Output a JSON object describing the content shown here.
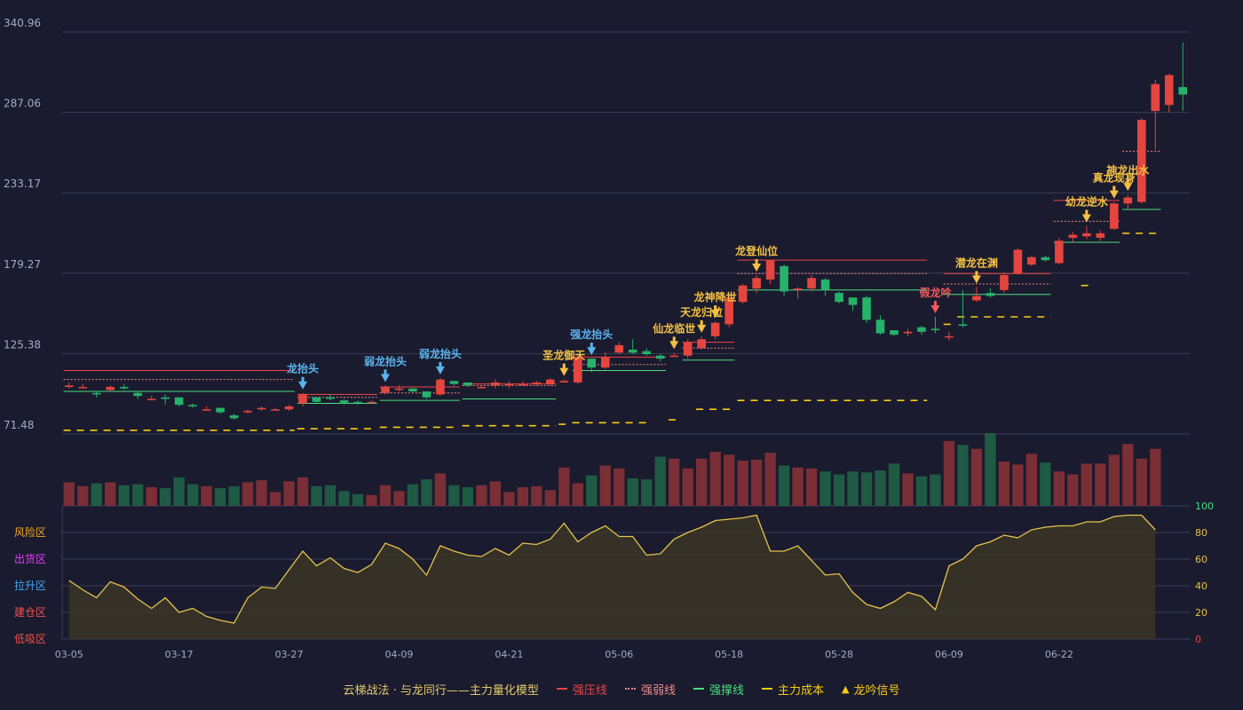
{
  "legend": {
    "title": "云梯战法 · 与龙同行——主力量化模型",
    "items": [
      {
        "label": "强压线",
        "color": "#ef4444",
        "style": "solid"
      },
      {
        "label": "强弱线",
        "color": "#f08a8a",
        "style": "dotted"
      },
      {
        "label": "强撑线",
        "color": "#4ade80",
        "style": "solid"
      },
      {
        "label": "主力成本",
        "color": "#facc15",
        "style": "dashed"
      },
      {
        "label": "龙吟信号",
        "color": "#facc15",
        "style": "triangle"
      }
    ]
  },
  "colors": {
    "background": "#1a1b2e",
    "grid": "#3a3d56",
    "up": "#e5453f",
    "down": "#25b26a",
    "volume_up": "#7a2e36",
    "volume_down": "#1f5a44",
    "oscillator": "#e6c34a",
    "cost_line": "#facc15",
    "signal_gold": "#f5c142",
    "signal_blue": "#5ab4f0",
    "signal_red": "#f05a5a"
  },
  "zones": [
    {
      "label": "风险区",
      "color": "#f5a623"
    },
    {
      "label": "出货区",
      "color": "#e040fb"
    },
    {
      "label": "拉升区",
      "color": "#42a5f5"
    },
    {
      "label": "建仓区",
      "color": "#ef5350"
    },
    {
      "label": "低吸区",
      "color": "#ef5350"
    }
  ],
  "chart_data": {
    "type": "candlestick",
    "y_axis": {
      "ticks": [
        "340.96",
        "287.06",
        "233.17",
        "179.27",
        "125.38",
        "71.48"
      ],
      "range": [
        71.48,
        340.96
      ]
    },
    "oscillator_axis": {
      "ticks": [
        "100",
        "80",
        "60",
        "40",
        "20",
        "0"
      ],
      "range": [
        0,
        100
      ]
    },
    "x_tick_labels": [
      {
        "i": 0,
        "label": "03-05"
      },
      {
        "i": 8,
        "label": "03-17"
      },
      {
        "i": 16,
        "label": "03-27"
      },
      {
        "i": 24,
        "label": "04-09"
      },
      {
        "i": 32,
        "label": "04-21"
      },
      {
        "i": 40,
        "label": "05-06"
      },
      {
        "i": 48,
        "label": "05-18"
      },
      {
        "i": 56,
        "label": "05-28"
      },
      {
        "i": 64,
        "label": "06-09"
      },
      {
        "i": 72,
        "label": "06-22"
      }
    ],
    "candles": [
      [
        103,
        104,
        106,
        102
      ],
      [
        103,
        103,
        105,
        102
      ],
      [
        99,
        98,
        100,
        96
      ],
      [
        101,
        103,
        104,
        100
      ],
      [
        103,
        102,
        105,
        101
      ],
      [
        99,
        97,
        100,
        95
      ],
      [
        95,
        95,
        97,
        94
      ],
      [
        96,
        95,
        98,
        91
      ],
      [
        96,
        91,
        96,
        90
      ],
      [
        91,
        90,
        92,
        89
      ],
      [
        88,
        88,
        90,
        87
      ],
      [
        89,
        86,
        89,
        85
      ],
      [
        84,
        82,
        85,
        81
      ],
      [
        86,
        87,
        88,
        85
      ],
      [
        88,
        89,
        90,
        87
      ],
      [
        88,
        88,
        89,
        87
      ],
      [
        88,
        90,
        91,
        87
      ],
      [
        92,
        98,
        99,
        90
      ],
      [
        96,
        93,
        96,
        92
      ],
      [
        96,
        95,
        98,
        94
      ],
      [
        94,
        92,
        95,
        91
      ],
      [
        93,
        92,
        94,
        91
      ],
      [
        93,
        93,
        94,
        92
      ],
      [
        99,
        103,
        104,
        98
      ],
      [
        101,
        102,
        104,
        100
      ],
      [
        102,
        100,
        102,
        99
      ],
      [
        100,
        96,
        100,
        95
      ],
      [
        98,
        108,
        109,
        97
      ],
      [
        107,
        105,
        107,
        104
      ],
      [
        106,
        104,
        106,
        103
      ],
      [
        103,
        103,
        104,
        102
      ],
      [
        104,
        106,
        108,
        102
      ],
      [
        104,
        105,
        107,
        102
      ],
      [
        105,
        105,
        107,
        104
      ],
      [
        105,
        106,
        107,
        104
      ],
      [
        105,
        108,
        109,
        104
      ],
      [
        106,
        107,
        108,
        106
      ],
      [
        106,
        123,
        124,
        105
      ],
      [
        122,
        116,
        122,
        113
      ],
      [
        116,
        123,
        126,
        115
      ],
      [
        126,
        131,
        133,
        125
      ],
      [
        128,
        126,
        135,
        125
      ],
      [
        127,
        125,
        129,
        124
      ],
      [
        124,
        122,
        125,
        120
      ],
      [
        124,
        124,
        126,
        124
      ],
      [
        124,
        133,
        135,
        122
      ],
      [
        129,
        135,
        137,
        128
      ],
      [
        137,
        146,
        147,
        135
      ],
      [
        145,
        163,
        164,
        143
      ],
      [
        160,
        171,
        172,
        159
      ],
      [
        169,
        176,
        178,
        166
      ],
      [
        175,
        188,
        188,
        172
      ],
      [
        184,
        167,
        185,
        164
      ],
      [
        168,
        169,
        170,
        162
      ],
      [
        169,
        176,
        178,
        167
      ],
      [
        175,
        168,
        176,
        164
      ],
      [
        166,
        160,
        167,
        159
      ],
      [
        163,
        158,
        163,
        154
      ],
      [
        163,
        148,
        164,
        146
      ],
      [
        148,
        139,
        151,
        138
      ],
      [
        141,
        138,
        141,
        137
      ],
      [
        139,
        140,
        142,
        137
      ],
      [
        143,
        140,
        144,
        138
      ],
      [
        142,
        141,
        150,
        139
      ],
      [
        137,
        137,
        140,
        134
      ],
      [
        145,
        144,
        168,
        143
      ],
      [
        161,
        164,
        170,
        160
      ],
      [
        166,
        164,
        169,
        163
      ],
      [
        168,
        178,
        180,
        166
      ],
      [
        179,
        195,
        196,
        178
      ],
      [
        185,
        190,
        191,
        184
      ],
      [
        190,
        188,
        191,
        187
      ],
      [
        186,
        201,
        203,
        185
      ],
      [
        203,
        205,
        207,
        200
      ],
      [
        204,
        206,
        211,
        202
      ],
      [
        203,
        206,
        208,
        201
      ],
      [
        209,
        226,
        227,
        208
      ],
      [
        226,
        230,
        232,
        222
      ],
      [
        227,
        282,
        283,
        226
      ],
      [
        288,
        306,
        309,
        262
      ],
      [
        292,
        312,
        313,
        287
      ],
      [
        304,
        299,
        334,
        288
      ]
    ],
    "volume": [
      24,
      20,
      23,
      24,
      21,
      22,
      19,
      18,
      29,
      22,
      20,
      18,
      20,
      24,
      26,
      14,
      25,
      29,
      20,
      21,
      15,
      12,
      11,
      21,
      15,
      22,
      27,
      33,
      21,
      19,
      21,
      25,
      14,
      19,
      20,
      16,
      39,
      23,
      31,
      41,
      38,
      28,
      27,
      50,
      48,
      38,
      48,
      55,
      52,
      46,
      47,
      54,
      41,
      39,
      38,
      35,
      32,
      35,
      34,
      36,
      43,
      33,
      30,
      32,
      66,
      62,
      58,
      74,
      45,
      42,
      53,
      44,
      35,
      32,
      43,
      43,
      52,
      63,
      48,
      58
    ],
    "oscillator": [
      44,
      37,
      31,
      43,
      39,
      30,
      23,
      31,
      20,
      23,
      17,
      14,
      12,
      31,
      39,
      38,
      52,
      66,
      55,
      61,
      53,
      50,
      56,
      72,
      68,
      60,
      48,
      70,
      66,
      63,
      62,
      68,
      63,
      72,
      71,
      75,
      87,
      73,
      80,
      85,
      77,
      77,
      63,
      64,
      75,
      80,
      84,
      89,
      90,
      91,
      93,
      66,
      66,
      70,
      59,
      48,
      49,
      35,
      26,
      23,
      28,
      35,
      32,
      22,
      55,
      60,
      70,
      73,
      78,
      76,
      82,
      84,
      85,
      85,
      88,
      88,
      92,
      93,
      93,
      82
    ],
    "resistance_segments": [
      [
        0,
        16,
        114
      ],
      [
        17,
        22,
        98
      ],
      [
        23,
        28,
        103
      ],
      [
        29,
        35,
        105
      ],
      [
        37,
        43,
        123
      ],
      [
        45,
        48,
        133
      ],
      [
        49,
        62,
        188
      ],
      [
        64,
        71,
        179
      ],
      [
        72,
        76,
        228
      ]
    ],
    "midline_segments": [
      [
        0,
        16,
        108
      ],
      [
        17,
        22,
        96
      ],
      [
        23,
        28,
        99
      ],
      [
        29,
        35,
        104
      ],
      [
        37,
        43,
        118
      ],
      [
        45,
        48,
        129
      ],
      [
        49,
        62,
        179
      ],
      [
        64,
        71,
        172
      ],
      [
        72,
        76,
        214
      ],
      [
        77,
        79,
        261
      ]
    ],
    "support_segments": [
      [
        0,
        16,
        100
      ],
      [
        17,
        22,
        92
      ],
      [
        23,
        28,
        94
      ],
      [
        29,
        35,
        95
      ],
      [
        37,
        43,
        114
      ],
      [
        45,
        48,
        121
      ],
      [
        49,
        62,
        168
      ],
      [
        64,
        71,
        165
      ],
      [
        72,
        76,
        200
      ],
      [
        77,
        79,
        222
      ]
    ],
    "cost_segments": [
      [
        0,
        16,
        74
      ],
      [
        17,
        22,
        75
      ],
      [
        23,
        28,
        76
      ],
      [
        29,
        35,
        77
      ],
      [
        36,
        36,
        78
      ],
      [
        37,
        42,
        79
      ],
      [
        44,
        44,
        81
      ],
      [
        46,
        48,
        88
      ],
      [
        49,
        62,
        94
      ],
      [
        64,
        64,
        145
      ],
      [
        65,
        71,
        150
      ],
      [
        74,
        74,
        171
      ],
      [
        77,
        79,
        206
      ]
    ],
    "signals": [
      {
        "i": 17,
        "label": "龙抬头",
        "color": "blue"
      },
      {
        "i": 23,
        "label": "弱龙抬头",
        "color": "blue"
      },
      {
        "i": 27,
        "label": "弱龙抬头",
        "color": "blue"
      },
      {
        "i": 36,
        "label": "圣龙御天",
        "color": "gold"
      },
      {
        "i": 38,
        "label": "强龙抬头",
        "color": "blue"
      },
      {
        "i": 44,
        "label": "仙龙临世",
        "color": "gold"
      },
      {
        "i": 46,
        "label": "天龙归位",
        "color": "gold"
      },
      {
        "i": 47,
        "label": "龙神降世",
        "color": "gold"
      },
      {
        "i": 50,
        "label": "龙登仙位",
        "color": "gold"
      },
      {
        "i": 63,
        "label": "假龙吟",
        "color": "red"
      },
      {
        "i": 66,
        "label": "潜龙在渊",
        "color": "gold"
      },
      {
        "i": 74,
        "label": "幼龙逆水",
        "color": "gold"
      },
      {
        "i": 76,
        "label": "真龙现身",
        "color": "gold"
      },
      {
        "i": 77,
        "label": "神龙出水",
        "color": "gold"
      }
    ]
  }
}
